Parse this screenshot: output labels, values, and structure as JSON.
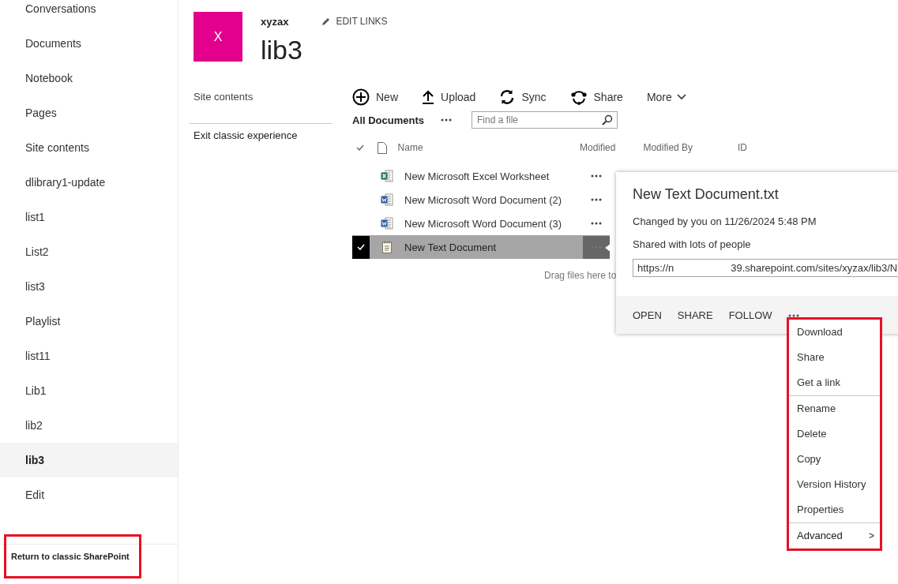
{
  "left_nav": {
    "items": [
      {
        "label": "Conversations",
        "selected": false
      },
      {
        "label": "Documents",
        "selected": false
      },
      {
        "label": "Notebook",
        "selected": false
      },
      {
        "label": "Pages",
        "selected": false
      },
      {
        "label": "Site contents",
        "selected": false
      },
      {
        "label": "dlibrary1-update",
        "selected": false
      },
      {
        "label": "list1",
        "selected": false
      },
      {
        "label": "List2",
        "selected": false
      },
      {
        "label": "list3",
        "selected": false
      },
      {
        "label": "Playlist",
        "selected": false
      },
      {
        "label": "list11",
        "selected": false
      },
      {
        "label": "Lib1",
        "selected": false
      },
      {
        "label": "lib2",
        "selected": false
      },
      {
        "label": "lib3",
        "selected": true
      },
      {
        "label": "Edit",
        "selected": false
      }
    ],
    "footer_link": {
      "label": "Return to classic SharePoint",
      "highlighted": true
    }
  },
  "site": {
    "logo_letter": "X",
    "name": "xyzax",
    "edit_links": "EDIT LINKS",
    "title": "lib3"
  },
  "quick_launch": {
    "items": [
      "Site contents",
      "Exit classic experience"
    ]
  },
  "commands": [
    {
      "label": "New",
      "kind": "new"
    },
    {
      "label": "Upload",
      "kind": "upload"
    },
    {
      "label": "Sync",
      "kind": "sync"
    },
    {
      "label": "Share",
      "kind": "share"
    },
    {
      "label": "More",
      "kind": "more"
    }
  ],
  "view": {
    "name": "All Documents",
    "search_placeholder": "Find a file"
  },
  "table": {
    "columns": [
      "Name",
      "Modified",
      "Modified By",
      "ID"
    ],
    "rows": [
      {
        "name": "New Microsoft Excel Worksheet",
        "kind": "excel",
        "selected": false
      },
      {
        "name": "New Microsoft Word Document (2)",
        "kind": "word",
        "selected": false
      },
      {
        "name": "New Microsoft Word Document (3)",
        "kind": "word",
        "selected": false
      },
      {
        "name": "New Text Document",
        "kind": "text",
        "selected": true
      }
    ]
  },
  "drop_hint": "Drag files here to",
  "callout": {
    "title": "New Text Document.txt",
    "changed": "Changed by you on 11/26/2024 5:48 PM",
    "shared": "Shared with lots of people",
    "url_start": "https://n",
    "url_end": "39.sharepoint.com/sites/xyzax/lib3/N",
    "actions": [
      "OPEN",
      "SHARE",
      "FOLLOW"
    ]
  },
  "menu": {
    "highlighted": true,
    "groups": [
      [
        {
          "label": "Download"
        },
        {
          "label": "Share"
        },
        {
          "label": "Get a link"
        }
      ],
      [
        {
          "label": "Rename"
        },
        {
          "label": "Delete"
        },
        {
          "label": "Copy"
        },
        {
          "label": "Version History"
        },
        {
          "label": "Properties"
        }
      ],
      [
        {
          "label": "Advanced",
          "submenu_mark": ">"
        }
      ]
    ]
  }
}
